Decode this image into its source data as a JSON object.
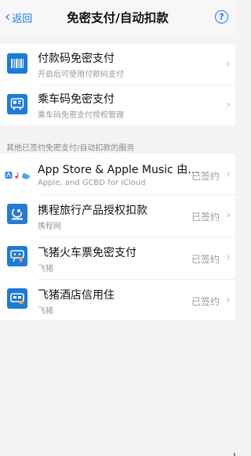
{
  "nav": {
    "back_label": "返回",
    "title": "免密支付/自动扣款",
    "help_label": "?"
  },
  "top_items": [
    {
      "name": "付款码免密支付",
      "subtitle": "开启后可使用付款码支付",
      "icon": "barcode-icon"
    },
    {
      "name": "乘车码免密支付",
      "subtitle": "乘车码免密支付授权管理",
      "icon": "transit-qr-icon"
    }
  ],
  "section_header": "其他已签约免密支付/自动扣款的服务",
  "services": [
    {
      "name": "App Store & Apple Music 由…",
      "subtitle": "Apple, and GCBD for iCloud",
      "status": "已签约",
      "icon": "app-store-icon"
    },
    {
      "name": "携程旅行产品授权扣款",
      "subtitle": "携程网",
      "status": "已签约",
      "icon": "ctrip-icon"
    },
    {
      "name": "飞猪火车票免密支付",
      "subtitle": "飞猪",
      "status": "已签约",
      "icon": "fliggy-train-icon"
    },
    {
      "name": "飞猪酒店信用住",
      "subtitle": "飞猪",
      "status": "已签约",
      "icon": "fliggy-hotel-icon"
    }
  ],
  "colors": {
    "accent": "#1677ff",
    "icon_blue": "#1b7bd8",
    "background": "#f4f4f6"
  }
}
